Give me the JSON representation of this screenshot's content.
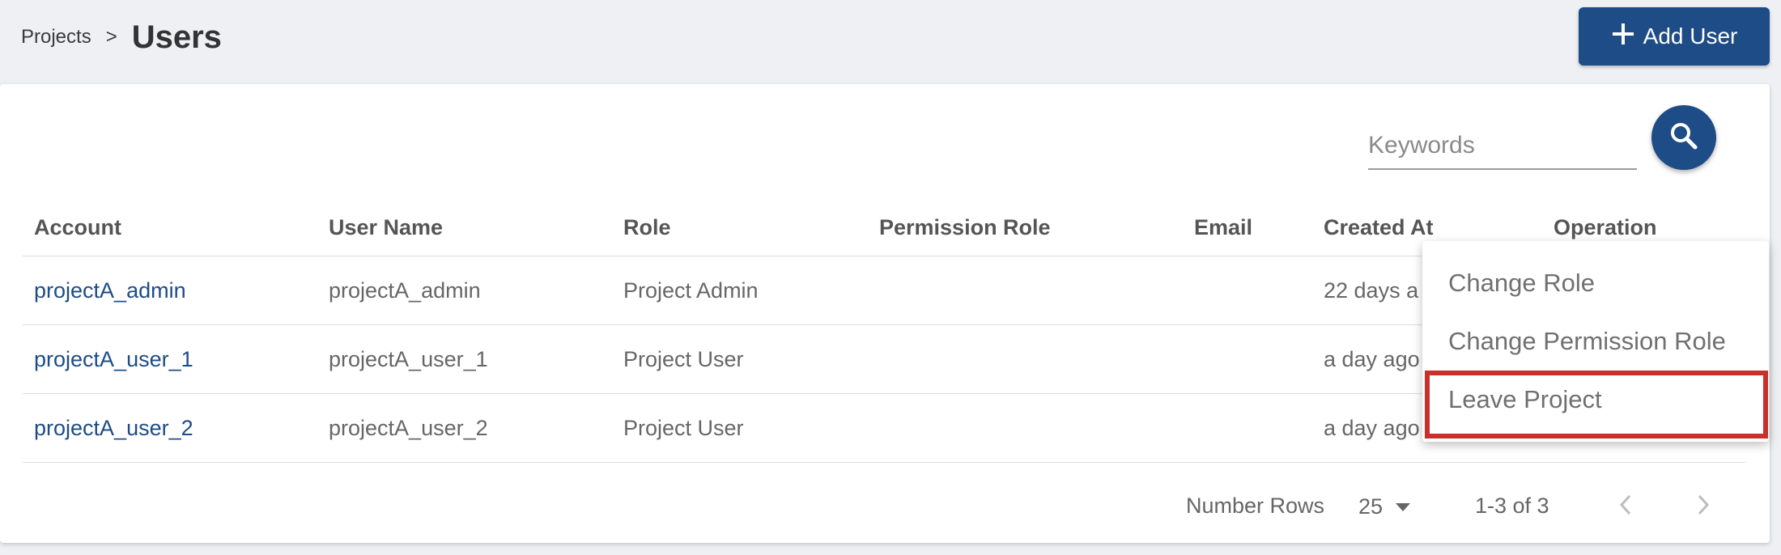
{
  "breadcrumb": {
    "parent": "Projects",
    "separator": ">",
    "current": "Users"
  },
  "toolbar": {
    "add_user_label": "Add User",
    "add_icon": "plus-icon"
  },
  "search": {
    "placeholder": "Keywords",
    "value": "",
    "icon": "search-icon"
  },
  "table": {
    "headers": {
      "account": "Account",
      "username": "User Name",
      "role": "Role",
      "permission_role": "Permission Role",
      "email": "Email",
      "created_at": "Created At",
      "operation": "Operation"
    },
    "rows": [
      {
        "account": "projectA_admin",
        "username": "projectA_admin",
        "role": "Project Admin",
        "permission_role": "",
        "email": "",
        "created_at": "22 days a"
      },
      {
        "account": "projectA_user_1",
        "username": "projectA_user_1",
        "role": "Project User",
        "permission_role": "",
        "email": "",
        "created_at": "a day ago"
      },
      {
        "account": "projectA_user_2",
        "username": "projectA_user_2",
        "role": "Project User",
        "permission_role": "",
        "email": "",
        "created_at": "a day ago"
      }
    ]
  },
  "pagination": {
    "rows_label": "Number Rows",
    "rows_value": "25",
    "range": "1-3 of 3"
  },
  "context_menu": {
    "items": [
      {
        "label": "Change Role"
      },
      {
        "label": "Change Permission Role"
      },
      {
        "label": "Leave Project",
        "highlighted": true
      }
    ]
  },
  "colors": {
    "primary": "#1e4c86",
    "highlight": "#c9302c",
    "background": "#eef0f4"
  }
}
